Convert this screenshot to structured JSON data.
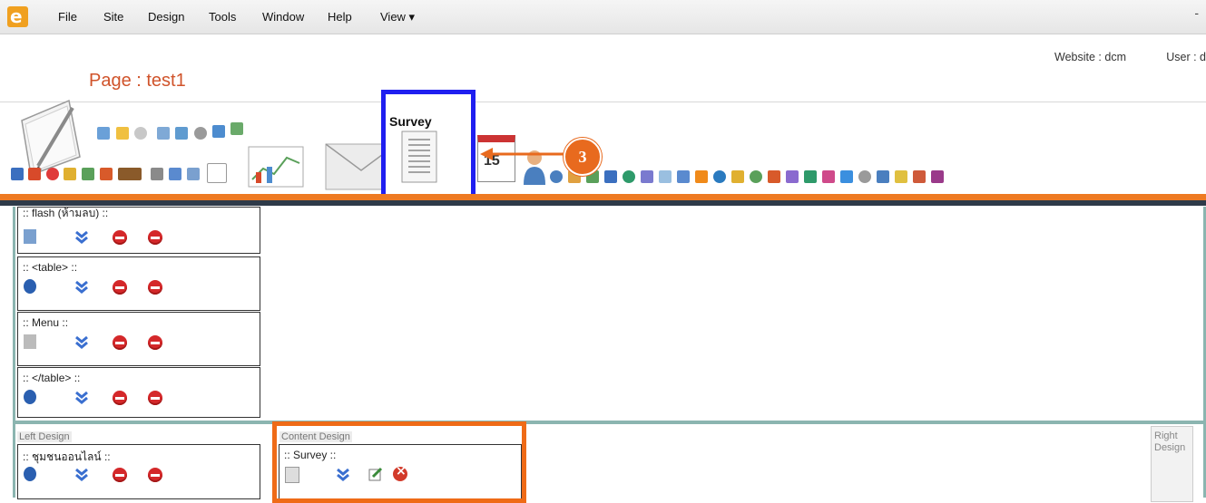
{
  "menubar": {
    "logo": "e",
    "items": [
      "File",
      "Site",
      "Design",
      "Tools",
      "Window",
      "Help",
      "View ▾"
    ],
    "minimize": "-"
  },
  "header": {
    "website": "Website : dcm",
    "user": "User : d",
    "page_title": "Page : test1"
  },
  "toolbar": {
    "survey_label": "Survey",
    "calendar_day": "15",
    "step_number": "3"
  },
  "top_modules": [
    {
      "title": ":: flash (ห้ามลบ) ::"
    },
    {
      "title": ":: <table> ::"
    },
    {
      "title": ":: Menu ::"
    },
    {
      "title": ":: </table> ::"
    }
  ],
  "columns": {
    "left_label": "Left Design",
    "content_label": "Content Design",
    "right_label": "Right Design",
    "left_module_title": ":: ชุมชนออนไลน์ ::",
    "content_module_title": ":: Survey ::"
  },
  "colors": {
    "accent_orange": "#ee7a22",
    "highlight_blue": "#1f1ff0",
    "teal_border": "#8bb5b0",
    "title_red": "#d0532a"
  }
}
